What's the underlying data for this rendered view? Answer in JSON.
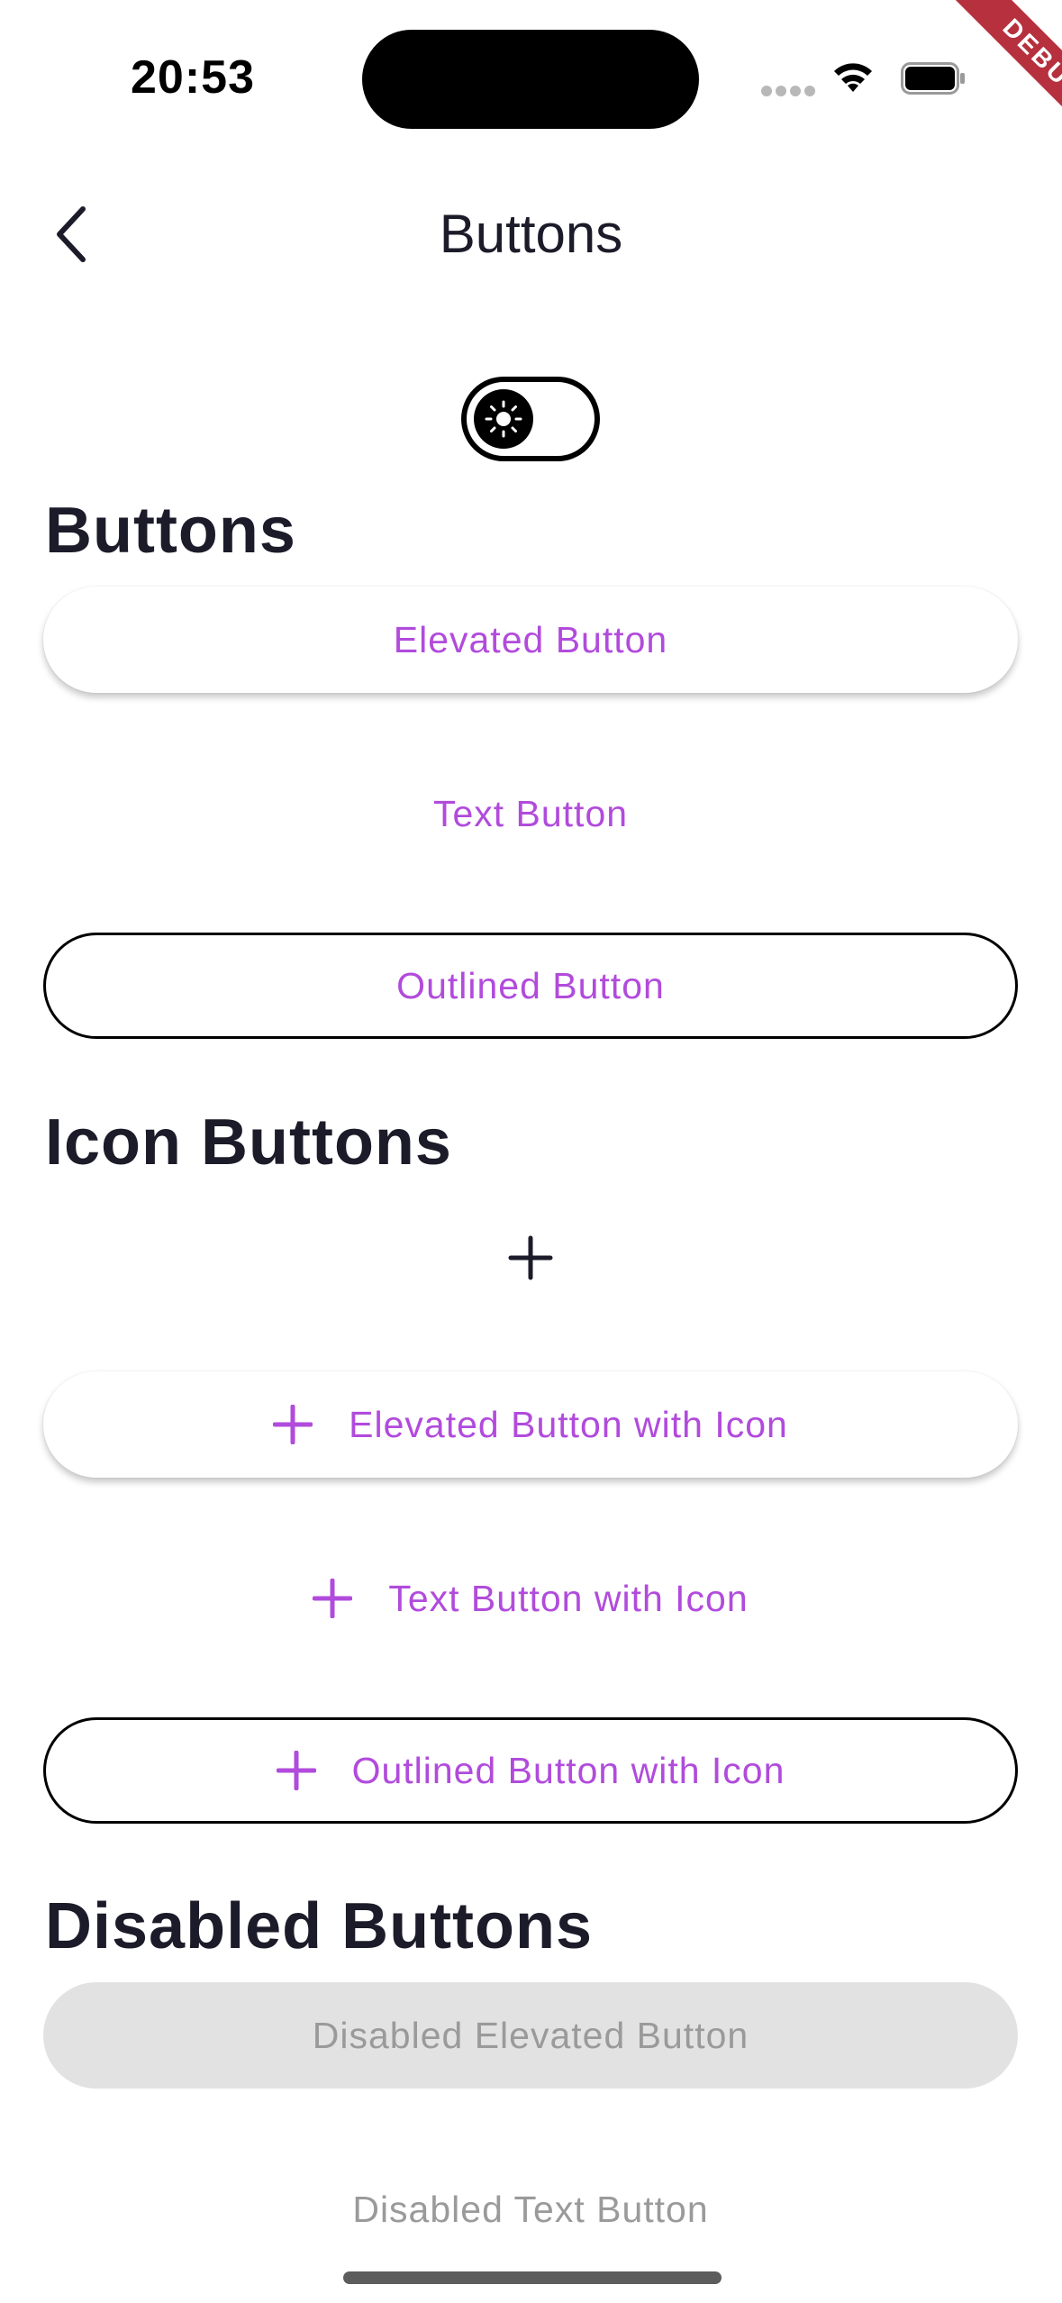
{
  "status_bar": {
    "time": "20:53"
  },
  "debug_banner": "DEBUG",
  "header": {
    "title": "Buttons"
  },
  "sections": {
    "buttons": {
      "title": "Buttons",
      "elevated": "Elevated Button",
      "text": "Text Button",
      "outlined": "Outlined Button"
    },
    "icon_buttons": {
      "title": "Icon Buttons",
      "elevated_icon": "Elevated Button with Icon",
      "text_icon": "Text Button with Icon",
      "outlined_icon": "Outlined Button with Icon"
    },
    "disabled_buttons": {
      "title": "Disabled Buttons",
      "elevated": "Disabled Elevated Button",
      "text": "Disabled Text Button"
    }
  },
  "icons": {
    "back": "chevron-left-icon",
    "theme_toggle": "sun-icon",
    "add": "plus-icon"
  },
  "colors": {
    "accent": "#b14bdc",
    "text_dark": "#1c1b29",
    "disabled_bg": "#e2e2e2",
    "disabled_text": "#9a9a9a",
    "debug_ribbon": "#b6303d"
  }
}
